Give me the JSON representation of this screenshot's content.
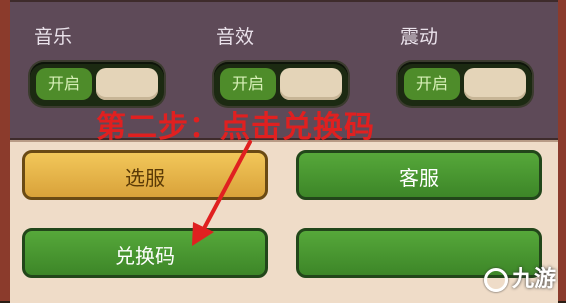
{
  "settings": {
    "music_label": "音乐",
    "sfx_label": "音效",
    "vibrate_label": "震动",
    "toggle_on_text": "开启"
  },
  "buttons": {
    "select_server": "选服",
    "customer_service": "客服",
    "redeem_code": "兑换码"
  },
  "annotation": {
    "text": "第二步：点击兑换码",
    "color": "#e02020"
  },
  "watermark": {
    "text": "九游"
  },
  "colors": {
    "panel_purple": "#5e4a58",
    "panel_cream": "#efdcc8",
    "button_green": "#4e9a34",
    "button_yellow": "#e6b44a"
  }
}
